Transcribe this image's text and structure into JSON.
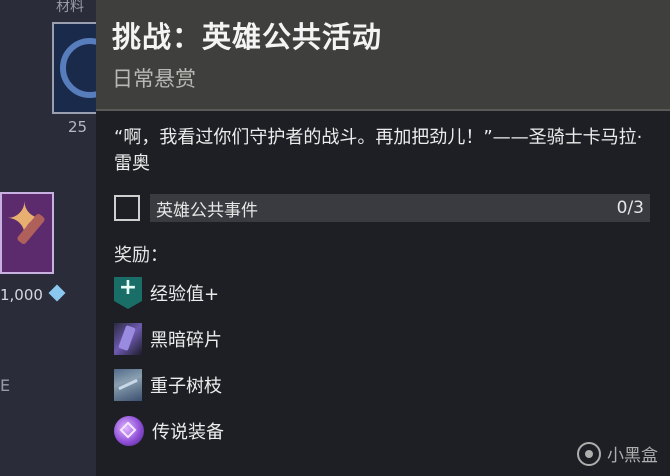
{
  "background": {
    "label_top": "材料",
    "tile1_count": "25",
    "tile2_price": "1,000",
    "side_char": "E"
  },
  "tooltip": {
    "title": "挑战：英雄公共活动",
    "subtitle": "日常悬赏",
    "description": "“啊，我看过你们守护者的战斗。再加把劲儿！”——圣骑士卡马拉·雷奥",
    "objective": {
      "label": "英雄公共事件",
      "progress": "0/3",
      "completed": false
    },
    "rewards_label": "奖励：",
    "rewards": [
      {
        "name": "经验值+",
        "icon": "xp-icon"
      },
      {
        "name": "黑暗碎片",
        "icon": "dark-shard-icon"
      },
      {
        "name": "重子树枝",
        "icon": "baryon-bough-icon"
      },
      {
        "name": "传说装备",
        "icon": "legendary-gear-icon"
      }
    ]
  },
  "watermark": {
    "text": "小黑盒"
  },
  "colors": {
    "header_bg": "#3f3f3d",
    "body_bg": "#1e1f24",
    "objective_bar": "#3a3b40",
    "xp_teal": "#1a6e68",
    "legendary_purple": "#9050d8"
  }
}
